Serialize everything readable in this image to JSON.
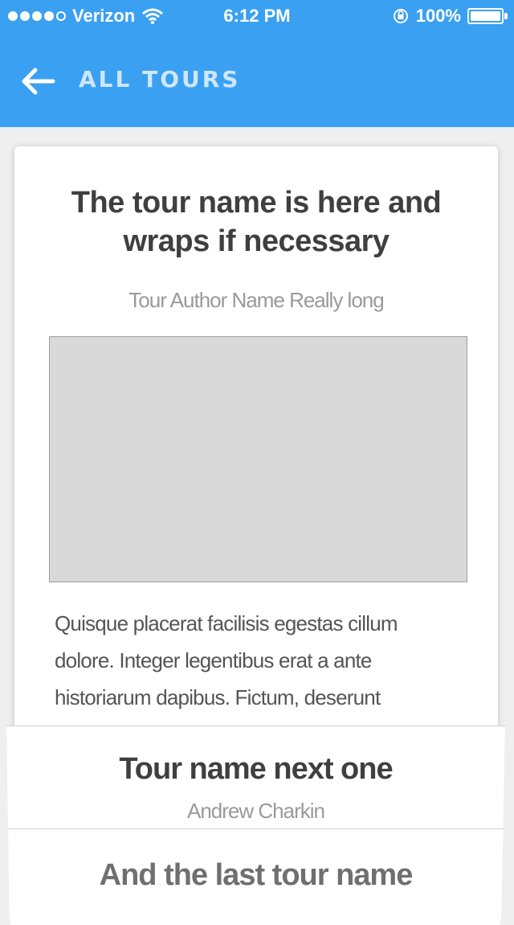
{
  "status_bar": {
    "carrier": "Verizon",
    "time": "6:12 PM",
    "battery": "100%",
    "signal_icon": "signal-dots-icon",
    "wifi_icon": "wifi-icon",
    "lock_icon": "orientation-lock-icon",
    "battery_icon": "battery-icon"
  },
  "nav": {
    "back_icon": "arrow-left-icon",
    "title": "ALL TOURS",
    "background": "#3aa0f2"
  },
  "current_tour": {
    "title": "The tour name is here and wraps if necessary",
    "author": "Tour Author Name Really long",
    "description": "Quisque placerat facilisis egestas cillum dolore. Integer legentibus erat a ante historiarum dapibus. Fictum, deserunt"
  },
  "next_tour": {
    "title": "Tour name next one",
    "author": "Andrew Charkin"
  },
  "last_tour": {
    "title": "And the last tour name"
  }
}
